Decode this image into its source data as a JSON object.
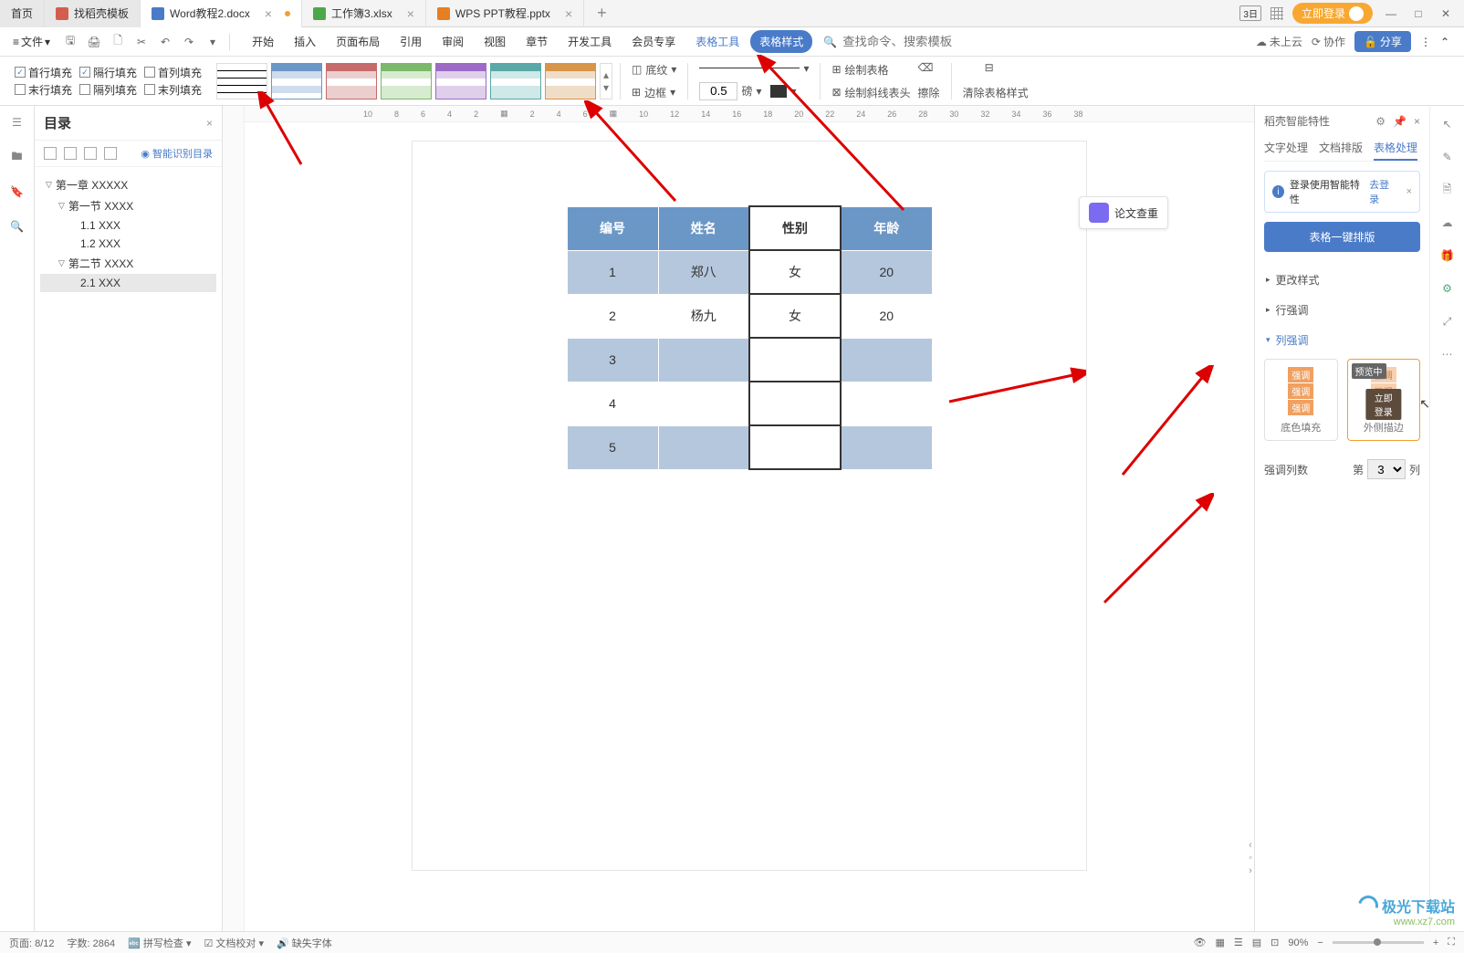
{
  "tabs": {
    "home": "首页",
    "template": "找稻壳模板",
    "word": "Word教程2.docx",
    "excel": "工作簿3.xlsx",
    "ppt": "WPS PPT教程.pptx"
  },
  "topRight": {
    "login": "立即登录"
  },
  "menu": {
    "file": "文件",
    "tabs": [
      "开始",
      "插入",
      "页面布局",
      "引用",
      "审阅",
      "视图",
      "章节",
      "开发工具",
      "会员专享",
      "表格工具",
      "表格样式"
    ],
    "searchPlaceholder": "查找命令、搜索模板",
    "cloud": "未上云",
    "collab": "协作",
    "share": "分享"
  },
  "ribbon": {
    "checks": {
      "r1": [
        "首行填充",
        "隔行填充",
        "首列填充"
      ],
      "r2": [
        "末行填充",
        "隔列填充",
        "末列填充"
      ]
    },
    "shading": "底纹",
    "border": "边框",
    "pt": "0.5",
    "ptUnit": "磅",
    "drawTable": "绘制表格",
    "drawDiag": "绘制斜线表头",
    "erase": "擦除",
    "clearStyle": "清除表格样式"
  },
  "ruler": [
    "10",
    "8",
    "6",
    "4",
    "2",
    "",
    "2",
    "4",
    "6",
    "8",
    "10",
    "12",
    "14",
    "16",
    "18",
    "20",
    "22",
    "24",
    "26",
    "28",
    "30",
    "32",
    "34",
    "36",
    "38"
  ],
  "outline": {
    "title": "目录",
    "smart": "智能识别目录",
    "items": {
      "ch1": "第一章 XXXXX",
      "s1": "第一节  XXXX",
      "s1_1": "1.1 XXX",
      "s1_2": "1.2 XXX",
      "s2": "第二节  XXXX",
      "s2_1": "2.1 XXX"
    }
  },
  "floatBtn": "论文查重",
  "table": {
    "headers": [
      "编号",
      "姓名",
      "性别",
      "年龄"
    ],
    "rows": [
      [
        "1",
        "郑八",
        "女",
        "20"
      ],
      [
        "2",
        "杨九",
        "女",
        "20"
      ],
      [
        "3",
        "",
        "",
        ""
      ],
      [
        "4",
        "",
        "",
        ""
      ],
      [
        "5",
        "",
        "",
        ""
      ]
    ]
  },
  "right": {
    "title": "稻壳智能特性",
    "tabs": [
      "文字处理",
      "文档排版",
      "表格处理"
    ],
    "infoText": "登录使用智能特性",
    "infoLink": "去登录",
    "bigBtn": "表格一键排版",
    "sections": {
      "style": "更改样式",
      "row": "行强调",
      "col": "列强调"
    },
    "preview": "预览中",
    "loginNow": "立即登录",
    "emp": {
      "fill": "底色填充",
      "outline": "外侧描边",
      "word": "强调"
    },
    "colLabel": "强调列数",
    "colPrefix": "第",
    "colVal": "3",
    "colSuffix": "列"
  },
  "status": {
    "page": "页面: 8/12",
    "words": "字数: 2864",
    "spell": "拼写检查",
    "content": "文档校对",
    "missing": "缺失字体",
    "zoom": "90%"
  },
  "watermark": {
    "name": "极光下载站",
    "url": "www.xz7.com"
  }
}
